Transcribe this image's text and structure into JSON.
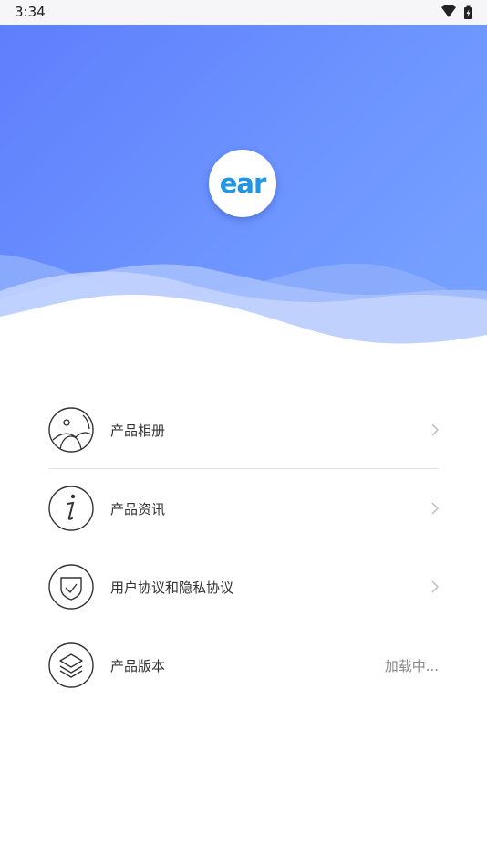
{
  "status_bar": {
    "time": "3:34"
  },
  "logo": {
    "text": "ear"
  },
  "colors": {
    "header_start": "#5f7efc",
    "header_end": "#79a4ff",
    "logo_text": "#1f97e6"
  },
  "menu": {
    "items": [
      {
        "label": "产品相册",
        "icon": "album-icon",
        "chevron": true
      },
      {
        "label": "产品资讯",
        "icon": "info-icon",
        "chevron": true
      },
      {
        "label": "用户协议和隐私协议",
        "icon": "shield-icon",
        "chevron": true
      },
      {
        "label": "产品版本",
        "icon": "layers-icon",
        "value": "加载中..."
      }
    ]
  }
}
